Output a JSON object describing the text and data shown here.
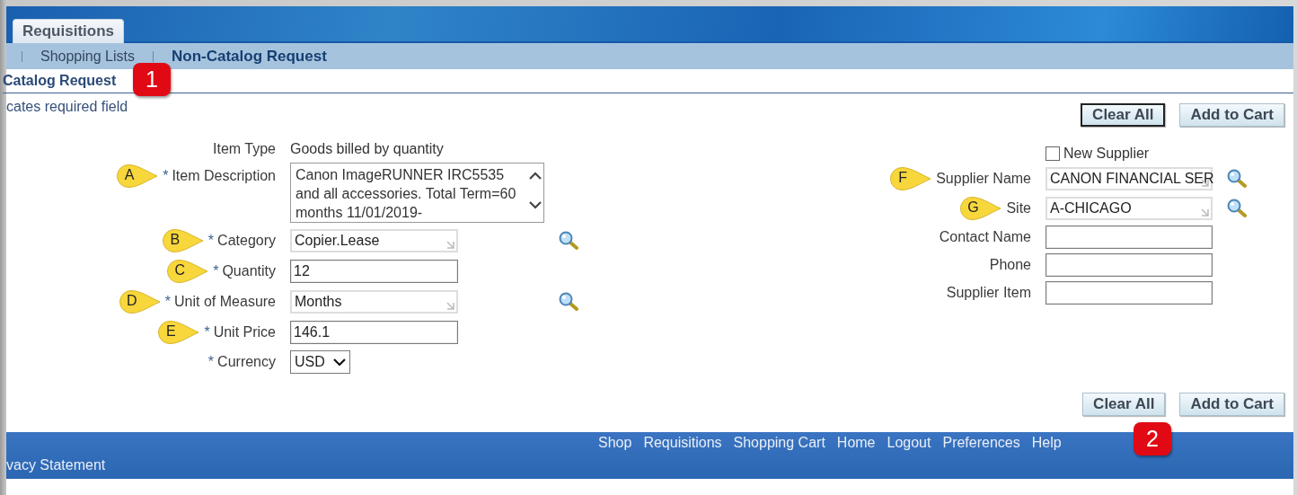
{
  "header": {
    "tabs": [
      {
        "label": "Requisitions",
        "selected": true
      }
    ]
  },
  "subnav": {
    "items": [
      {
        "label": "Shopping Lists",
        "selected": false
      },
      {
        "label": "Non-Catalog Request",
        "selected": true
      }
    ]
  },
  "page_title": "Catalog Request",
  "required_note": "cates required field",
  "top_buttons": [
    {
      "label": "Clear All",
      "focused": true
    },
    {
      "label": "Add to Cart",
      "focused": false
    }
  ],
  "left_fields": [
    {
      "label": "Item Type",
      "kind": "text",
      "value": "Goods billed by quantity"
    },
    {
      "label": "Item Description",
      "mark": "*",
      "kind": "textarea",
      "value": "Canon ImageRUNNER IRC5535 and all accessories. Total Term=60 months 11/01/2019-",
      "callout": "A"
    },
    {
      "label": "Category",
      "mark": "*",
      "kind": "lov",
      "value": "Copier.Lease",
      "callout": "B"
    },
    {
      "label": "Quantity",
      "mark": "*",
      "kind": "input",
      "value": "12",
      "callout": "C"
    },
    {
      "label": "Unit of Measure",
      "mark": "*",
      "kind": "lov",
      "value": "Months",
      "callout": "D"
    },
    {
      "label": "Unit Price",
      "mark": "*",
      "kind": "input",
      "value": "146.1",
      "callout": "E"
    },
    {
      "label": "Currency",
      "mark": "*",
      "kind": "select",
      "value": "USD"
    }
  ],
  "new_supplier": {
    "label": "New Supplier",
    "checked": false
  },
  "right_fields": [
    {
      "label": "Supplier Name",
      "kind": "lov",
      "value": "CANON FINANCIAL SER",
      "callout": "F"
    },
    {
      "label": "Site",
      "kind": "lov",
      "value": "A-CHICAGO",
      "callout": "G"
    },
    {
      "label": "Contact Name",
      "kind": "input"
    },
    {
      "label": "Phone",
      "kind": "input"
    },
    {
      "label": "Supplier Item",
      "kind": "input"
    }
  ],
  "bottom_buttons": [
    {
      "label": "Clear All",
      "focused": false
    },
    {
      "label": "Add to Cart",
      "focused": false
    }
  ],
  "step_badges": [
    {
      "label": "1"
    },
    {
      "label": "2"
    }
  ],
  "footer": {
    "links": [
      "Shop",
      "Requisitions",
      "Shopping Cart",
      "Home",
      "Logout",
      "Preferences",
      "Help"
    ],
    "privacy": "vacy Statement"
  }
}
